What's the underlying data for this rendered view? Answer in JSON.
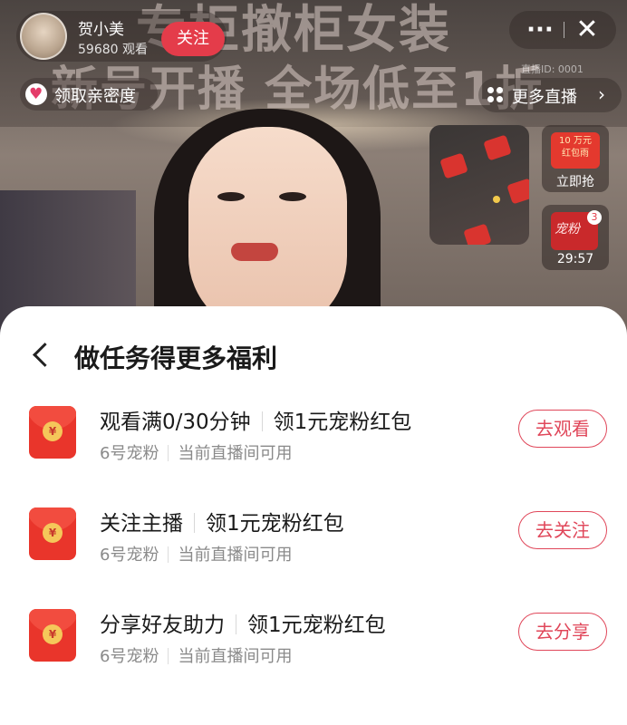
{
  "live": {
    "banner_line1": "专柜撤柜女装",
    "banner_line2": "新号开播 全场低至1折",
    "anchor_name": "贺小美",
    "viewers": "59680 观看",
    "follow_label": "关注",
    "room_id": "直播ID: 0001",
    "intimacy_label": "领取亲密度",
    "more_live_label": "更多直播",
    "more_icon": "···",
    "close_icon": "✕",
    "widget_redpacket_text": "10 万元\n红包雨",
    "widget_redpacket_cta": "立即抢",
    "widget_fans_text": "宠粉",
    "widget_fans_badge": "3",
    "widget_fans_timer": "29:57"
  },
  "sheet": {
    "title": "做任务得更多福利",
    "tasks": [
      {
        "title": "观看满0/30分钟",
        "reward": "领1元宠粉红包",
        "tag": "6号宠粉",
        "scope": "当前直播间可用",
        "button": "去观看"
      },
      {
        "title": "关注主播",
        "reward": "领1元宠粉红包",
        "tag": "6号宠粉",
        "scope": "当前直播间可用",
        "button": "去关注"
      },
      {
        "title": "分享好友助力",
        "reward": "领1元宠粉红包",
        "tag": "6号宠粉",
        "scope": "当前直播间可用",
        "button": "去分享"
      }
    ]
  },
  "colors": {
    "accent": "#e0475a",
    "follow": "#e43c4a",
    "envelope": "#e9352b"
  }
}
